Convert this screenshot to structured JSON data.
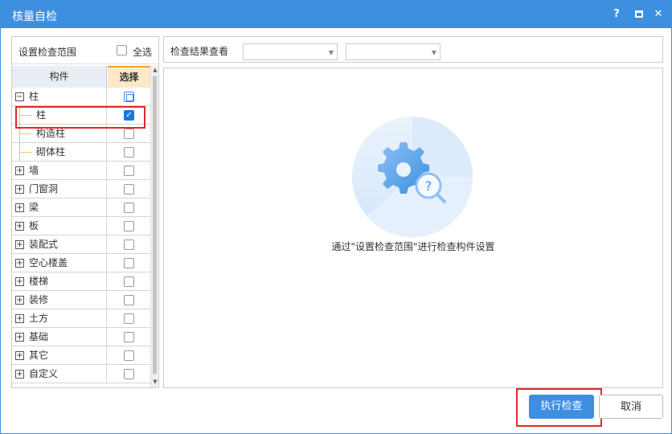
{
  "window": {
    "title": "核量自检",
    "help_label": "?",
    "close_label": "✕"
  },
  "left": {
    "title": "设置检查范围",
    "select_all_label": "全选",
    "columns": {
      "name": "构件",
      "select": "选择"
    },
    "rows": [
      {
        "label": "柱",
        "expander": "−",
        "state": "partial"
      },
      {
        "label": "柱",
        "child": true,
        "state": "checked"
      },
      {
        "label": "构造柱",
        "child": true,
        "state": "unchecked"
      },
      {
        "label": "砌体柱",
        "child": true,
        "state": "unchecked"
      },
      {
        "label": "墙",
        "expander": "+",
        "state": "unchecked"
      },
      {
        "label": "门窗洞",
        "expander": "+",
        "state": "unchecked"
      },
      {
        "label": "梁",
        "expander": "+",
        "state": "unchecked"
      },
      {
        "label": "板",
        "expander": "+",
        "state": "unchecked"
      },
      {
        "label": "装配式",
        "expander": "+",
        "state": "unchecked"
      },
      {
        "label": "空心楼盖",
        "expander": "+",
        "state": "unchecked"
      },
      {
        "label": "楼梯",
        "expander": "+",
        "state": "unchecked"
      },
      {
        "label": "装修",
        "expander": "+",
        "state": "unchecked"
      },
      {
        "label": "土方",
        "expander": "+",
        "state": "unchecked"
      },
      {
        "label": "基础",
        "expander": "+",
        "state": "unchecked"
      },
      {
        "label": "其它",
        "expander": "+",
        "state": "unchecked"
      },
      {
        "label": "自定义",
        "expander": "+",
        "state": "unchecked"
      }
    ]
  },
  "right": {
    "results_label": "检查结果查看",
    "dropdown1_value": "",
    "dropdown2_value": "",
    "empty_hint": "通过\"设置检查范围\"进行检查构件设置"
  },
  "buttons": {
    "run": "执行检查",
    "cancel": "取消"
  },
  "colors": {
    "accent": "#3d8fe0",
    "highlight": "#e0282e",
    "header_select_bg": "#fde9c9"
  }
}
